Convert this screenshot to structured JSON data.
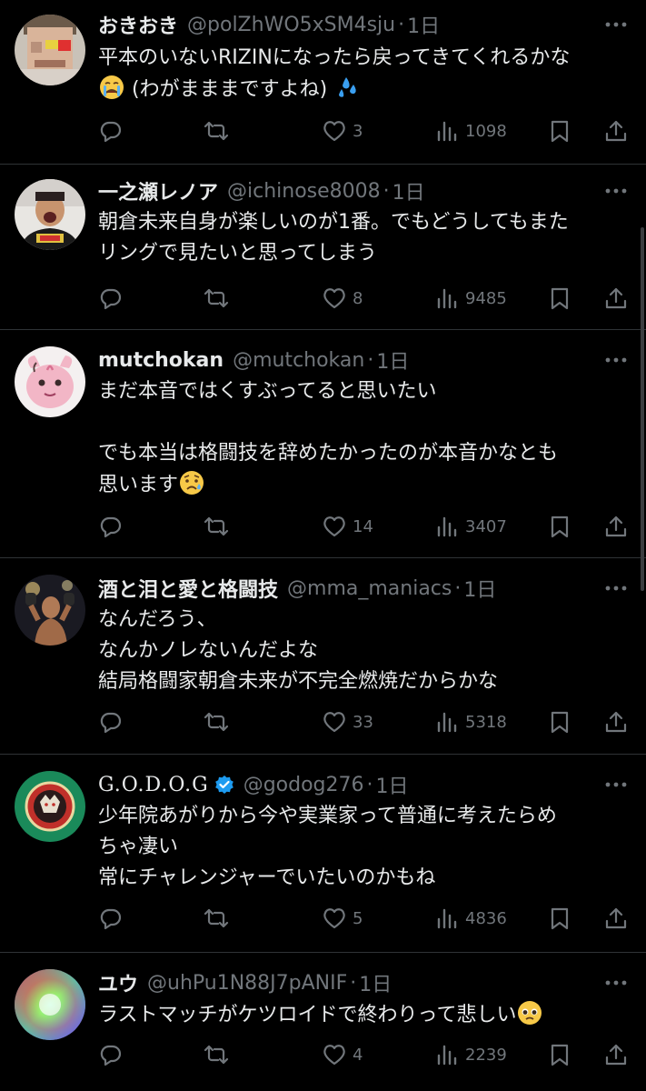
{
  "tweets": [
    {
      "name": "おきおき",
      "handle": "@polZhWO5xSM4sju",
      "time": "1日",
      "text_lines": [
        "平本のいないRIZINになったら戻ってきてくれるかな",
        "(わがまままですよね)"
      ],
      "likes": "3",
      "views": "1098",
      "avatar_icon": "pixelated-face-icon"
    },
    {
      "name": "一之瀬レノア",
      "handle": "@ichinose8008",
      "time": "1日",
      "text": "朝倉未来自身が楽しいのが1番。でもどうしてもまた\nリングで見たいと思ってしまう",
      "likes": "8",
      "views": "9485",
      "avatar_icon": "person-photo-icon"
    },
    {
      "name": "mutchokan",
      "handle": "@mutchokan",
      "time": "1日",
      "text": "まだ本音ではくすぶってると思いたい\n\nでも本当は格闘技を辞めたかったのが本音かなとも\n思います",
      "likes": "14",
      "views": "3407",
      "avatar_icon": "pink-character-icon"
    },
    {
      "name": "酒と泪と愛と格闘技",
      "handle": "@mma_maniacs",
      "time": "1日",
      "text": "なんだろう、\nなんかノレないんだよな\n結局格闘家朝倉未来が不完全燃焼だからかな",
      "likes": "33",
      "views": "5318",
      "avatar_icon": "fighter-photo-icon"
    },
    {
      "name": "G.O.D.O.G",
      "handle": "@godog276",
      "time": "1日",
      "text": "少年院あがりから今や実業家って普通に考えたらめ\nちゃ凄い\n常にチャレンジャーでいたいのかもね",
      "likes": "5",
      "views": "4836",
      "avatar_icon": "dog-emblem-icon"
    },
    {
      "name": "ユウ",
      "handle": "@uhPu1N88J7pANIF",
      "time": "1日",
      "text": "ラストマッチがケツロイドで終わりって悲しい",
      "likes": "4",
      "views": "2239",
      "avatar_icon": "rainbow-gradient-icon"
    }
  ],
  "colors": {
    "background": "#000000",
    "text": "#e7e9ea",
    "muted": "#71767b",
    "divider": "#2f3336",
    "verified": "#1d9bf0"
  }
}
